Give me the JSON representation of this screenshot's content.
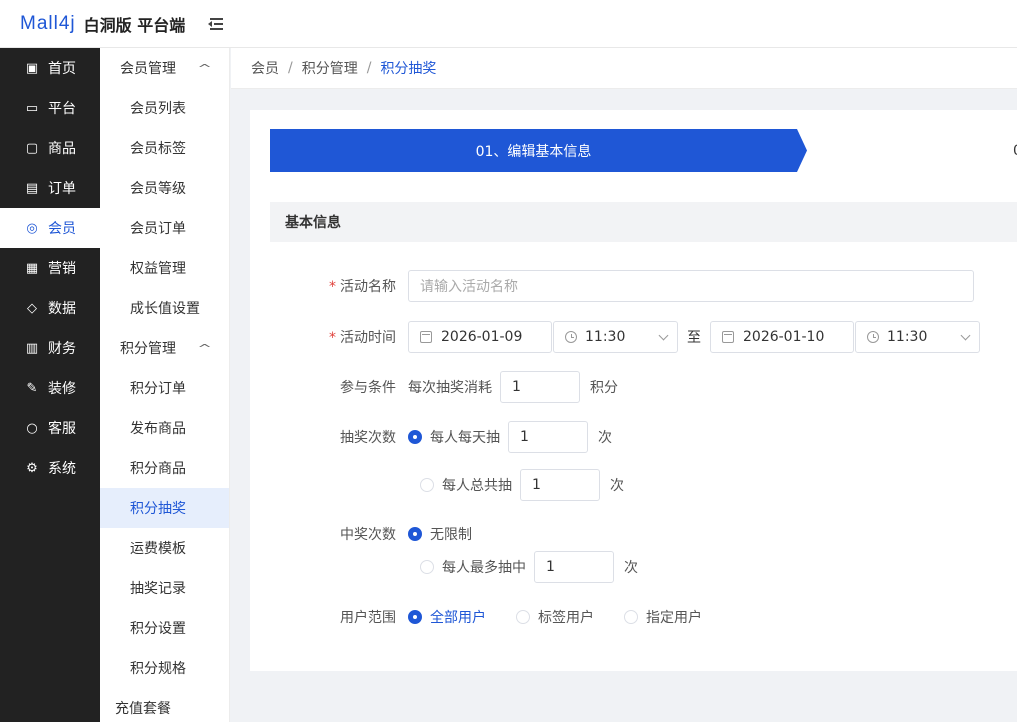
{
  "app": {
    "logo": "Mall4j",
    "title": "白洞版 平台端"
  },
  "primary_nav": [
    {
      "label": "首页",
      "icon": "home-icon",
      "glyph": "▣",
      "active": false
    },
    {
      "label": "平台",
      "icon": "monitor-icon",
      "glyph": "▭",
      "active": false
    },
    {
      "label": "商品",
      "icon": "box-icon",
      "glyph": "▢",
      "active": false
    },
    {
      "label": "订单",
      "icon": "order-icon",
      "glyph": "▤",
      "active": false
    },
    {
      "label": "会员",
      "icon": "user-icon",
      "glyph": "◎",
      "active": true
    },
    {
      "label": "营销",
      "icon": "gift-icon",
      "glyph": "▦",
      "active": false
    },
    {
      "label": "数据",
      "icon": "chart-icon",
      "glyph": "◇",
      "active": false
    },
    {
      "label": "财务",
      "icon": "finance-icon",
      "glyph": "▥",
      "active": false
    },
    {
      "label": "装修",
      "icon": "brush-icon",
      "glyph": "✎",
      "active": false
    },
    {
      "label": "客服",
      "icon": "chat-icon",
      "glyph": "○",
      "active": false
    },
    {
      "label": "系统",
      "icon": "gear-icon",
      "glyph": "⚙",
      "active": false
    }
  ],
  "secondary_nav": {
    "group1": "会员管理",
    "group1_items": [
      "会员列表",
      "会员标签",
      "会员等级",
      "会员订单",
      "权益管理",
      "成长值设置"
    ],
    "group2": "积分管理",
    "group2_items": [
      "积分订单",
      "发布商品",
      "积分商品",
      "积分抽奖",
      "运费模板",
      "抽奖记录",
      "积分设置",
      "积分规格"
    ],
    "active_item": "积分抽奖",
    "extra_item": "充值套餐",
    "chevron": "^"
  },
  "breadcrumb": [
    "会员",
    "积分管理",
    "积分抽奖"
  ],
  "breadcrumb_sep": "/",
  "steps": {
    "step1": "01、编辑基本信息",
    "step2_partial": "0"
  },
  "section_title": "基本信息",
  "form": {
    "name_label": "活动名称",
    "name_placeholder": "请输入活动名称",
    "time_label": "活动时间",
    "start_date": "2026-01-09",
    "start_time": "11:30",
    "to_label": "至",
    "end_date": "2026-01-10",
    "end_time": "11:30",
    "cond_label": "参与条件",
    "cond_text": "每次抽奖消耗",
    "cond_value": "1",
    "cond_unit": "积分",
    "draws_label": "抽奖次数",
    "daily_label": "每人每天抽",
    "daily_value": "1",
    "total_label": "每人总共抽",
    "total_value": "1",
    "times_unit": "次",
    "win_label": "中奖次数",
    "unlimited_label": "无限制",
    "max_label": "每人最多抽中",
    "max_value": "1",
    "range_label": "用户范围",
    "range_all": "全部用户",
    "range_tag": "标签用户",
    "range_specific": "指定用户",
    "required_mark": "*"
  },
  "colors": {
    "accent": "#1f57d6",
    "sidebar": "#222222",
    "required": "#e0413b"
  }
}
